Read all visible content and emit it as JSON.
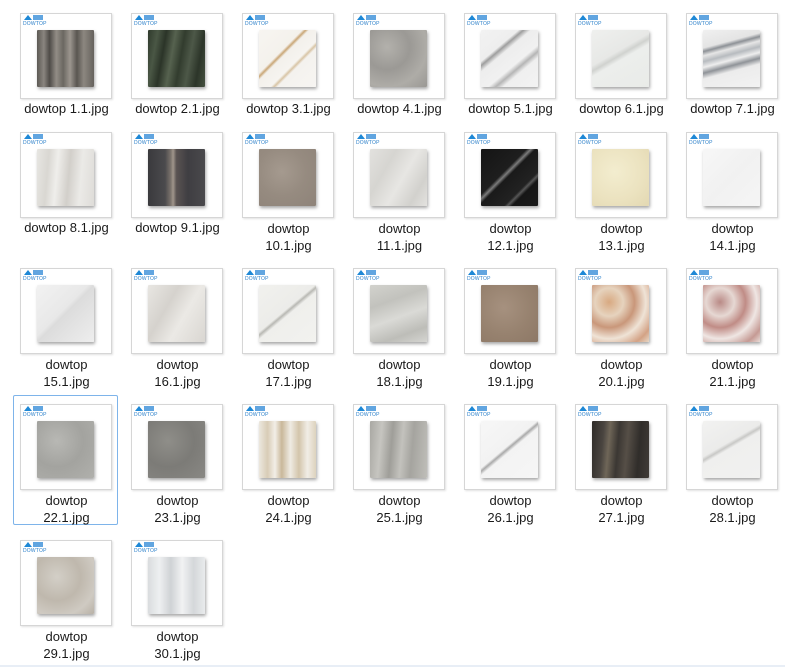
{
  "logo_text": "DOWTOP",
  "files": [
    {
      "name": "dowtop 1.1.jpg",
      "wrap": false,
      "bg": "linear-gradient(90deg,#5d5a55 0%,#8a857f 12%,#4f4c48 22%,#928d86 34%,#6b6761 46%,#9c968f 58%,#5a5651 70%,#8c8780 82%,#66625d 100%)"
    },
    {
      "name": "dowtop 2.1.jpg",
      "wrap": false,
      "bg": "linear-gradient(100deg,#2f3a2c 0%,#4a5745 15%,#2b3428 28%,#56624f 42%,#323c2e 56%,#4d5848 70%,#2c3529 85%,#455140 100%)"
    },
    {
      "name": "dowtop 3.1.jpg",
      "wrap": false,
      "bg": "linear-gradient(135deg,#f7f5f1 0%,#f4f1ec 38%,#c9a675 41%,#f3f0eb 44%,#f6f4f0 60%,#d8c4a5 63%,#f4f2ee 66%,#f7f5f2 100%)"
    },
    {
      "name": "dowtop 4.1.jpg",
      "wrap": false,
      "bg": "radial-gradient(circle at 30% 30%,#b3b1ac 0%,#9b9995 40%,#aeaca7 70%,#9a9894 100%)"
    },
    {
      "name": "dowtop 5.1.jpg",
      "wrap": false,
      "bg": "linear-gradient(140deg,#f2f2f2 0%,#eeeeee 30%,#9e9e9e 34%,#ededed 40%,#f1f1f1 60%,#b5b5b5 66%,#efefef 72%,#f3f3f3 100%)"
    },
    {
      "name": "dowtop 6.1.jpg",
      "wrap": false,
      "bg": "linear-gradient(150deg,#eff0ee 0%,#e7e8e6 40%,#d0d2cf 46%,#eceeec 52%,#e9ebe8 100%)"
    },
    {
      "name": "dowtop 7.1.jpg",
      "wrap": false,
      "bg": "linear-gradient(165deg,#f0f0f0 0%,#e4e4e4 25%,#8d9196 30%,#e6e6e6 36%,#b7bbbf 44%,#eeeeee 52%,#8f9398 60%,#ececec 68%,#f2f2f2 100%)"
    },
    {
      "name": "dowtop 8.1.jpg",
      "wrap": false,
      "bg": "linear-gradient(95deg,#e7e6e2 0%,#d9d7d2 20%,#efeeeb 35%,#d2cfca 55%,#ebeae7 75%,#dedcd8 100%)"
    },
    {
      "name": "dowtop 9.1.jpg",
      "wrap": false,
      "bg": "linear-gradient(90deg,#3a3a3d 0%,#4b4a4d 30%,#7c746d 40%,#a0958b 44%,#5a5352 50%,#3f3e42 70%,#4a494c 100%)"
    },
    {
      "name": "dowtop 10.1.jpg",
      "wrap": true,
      "bg": "radial-gradient(circle at 40% 40%,#a59a8f 0%,#968b80 50%,#8e8379 100%)"
    },
    {
      "name": "dowtop 11.1.jpg",
      "wrap": true,
      "bg": "linear-gradient(120deg,#e2e1de 0%,#d6d5d1 30%,#e7e6e3 55%,#d2d1cd 80%,#e3e2df 100%)"
    },
    {
      "name": "dowtop 12.1.jpg",
      "wrap": true,
      "bg": "linear-gradient(135deg,#141414 0%,#1e1e1e 40%,#7c7c7c 44%,#1a1a1a 48%,#222222 70%,#575757 73%,#161616 77%,#1b1b1b 100%)"
    },
    {
      "name": "dowtop 13.1.jpg",
      "wrap": true,
      "bg": "radial-gradient(circle at 40% 40%,#f3edcf 0%,#ebe2bf 60%,#e3d8b2 100%)"
    },
    {
      "name": "dowtop 14.1.jpg",
      "wrap": true,
      "bg": "linear-gradient(135deg,#f7f7f7 0%,#f1f1f1 50%,#f5f5f5 100%)"
    },
    {
      "name": "dowtop 15.1.jpg",
      "wrap": true,
      "bg": "linear-gradient(135deg,#f2f2f2 0%,#e8e8e8 45%,#dcdcdc 50%,#eeeeee 100%)"
    },
    {
      "name": "dowtop 16.1.jpg",
      "wrap": true,
      "bg": "linear-gradient(120deg,#e8e6e2 0%,#d5d2cd 35%,#ebe9e5 60%,#d9d6d1 100%)"
    },
    {
      "name": "dowtop 17.1.jpg",
      "wrap": true,
      "bg": "linear-gradient(140deg,#f1f1ee 0%,#ecece9 45%,#b8b8b3 48%,#efefec 52%,#f2f2ef 100%)"
    },
    {
      "name": "dowtop 18.1.jpg",
      "wrap": true,
      "bg": "linear-gradient(160deg,#d2d2cd 0%,#c2c2bd 30%,#dadad6 55%,#bdbdb8 80%,#d5d5d1 100%)"
    },
    {
      "name": "dowtop 19.1.jpg",
      "wrap": true,
      "bg": "radial-gradient(circle at 40% 40%,#a6917f 0%,#97826f 55%,#8d7866 100%)"
    },
    {
      "name": "dowtop 20.1.jpg",
      "wrap": true,
      "bg": "radial-gradient(circle at 30% 30%,#d8a981 0%,#e6d3be 25%,#c9977a 45%,#efe3d6 65%,#d3a285 85%,#e8d8c7 100%)"
    },
    {
      "name": "dowtop 21.1.jpg",
      "wrap": true,
      "bg": "radial-gradient(circle at 30% 30%,#b98a86 0%,#e6d8d3 25%,#c08c86 45%,#efe6e3 65%,#c59a94 85%,#e9dcd8 100%)"
    },
    {
      "name": "dowtop 22.1.jpg",
      "wrap": true,
      "bg": "radial-gradient(circle at 35% 35%,#b8b8b4 0%,#a3a39f 50%,#b0b0ac 100%)"
    },
    {
      "name": "dowtop 23.1.jpg",
      "wrap": true,
      "bg": "radial-gradient(circle at 35% 35%,#8f8e89 0%,#7c7b77 50%,#898884 100%)"
    },
    {
      "name": "dowtop 24.1.jpg",
      "wrap": true,
      "bg": "linear-gradient(90deg,#ece8df 0%,#d8ccb6 15%,#f2eee7 28%,#c9b89a 40%,#efebe3 55%,#d3c5ab 70%,#f1ede6 85%,#ddd2bd 100%)"
    },
    {
      "name": "dowtop 25.1.jpg",
      "wrap": true,
      "bg": "linear-gradient(95deg,#a9a8a3 0%,#c6c5c0 20%,#9f9e99 38%,#c3c2bd 55%,#a5a49f 72%,#bfbeb9 100%)"
    },
    {
      "name": "dowtop 26.1.jpg",
      "wrap": true,
      "bg": "linear-gradient(140deg,#f7f7f7 0%,#f2f2f2 45%,#a9a9a9 48%,#f3f3f3 52%,#f6f6f6 100%)"
    },
    {
      "name": "dowtop 27.1.jpg",
      "wrap": true,
      "bg": "linear-gradient(95deg,#2e2b28 0%,#4a4540 20%,#6f6658 30%,#3b3733 45%,#564f47 60%,#302d2a 80%,#403b37 100%)"
    },
    {
      "name": "dowtop 28.1.jpg",
      "wrap": true,
      "bg": "linear-gradient(150deg,#f2f2f1 0%,#ebebea 40%,#c8c8c6 44%,#efefee 48%,#f1f1f0 100%)"
    },
    {
      "name": "dowtop 29.1.jpg",
      "wrap": true,
      "bg": "radial-gradient(circle at 35% 35%,#d3cfc7 0%,#bfb8ad 45%,#cfcac2 75%,#b8b1a6 100%)"
    },
    {
      "name": "dowtop 30.1.jpg",
      "wrap": true,
      "bg": "linear-gradient(90deg,#d9dcde 0%,#eef0f1 20%,#cfd2d5 40%,#f1f2f3 60%,#d4d7da 80%,#e9ebec 100%)"
    }
  ],
  "selected_index": 21
}
